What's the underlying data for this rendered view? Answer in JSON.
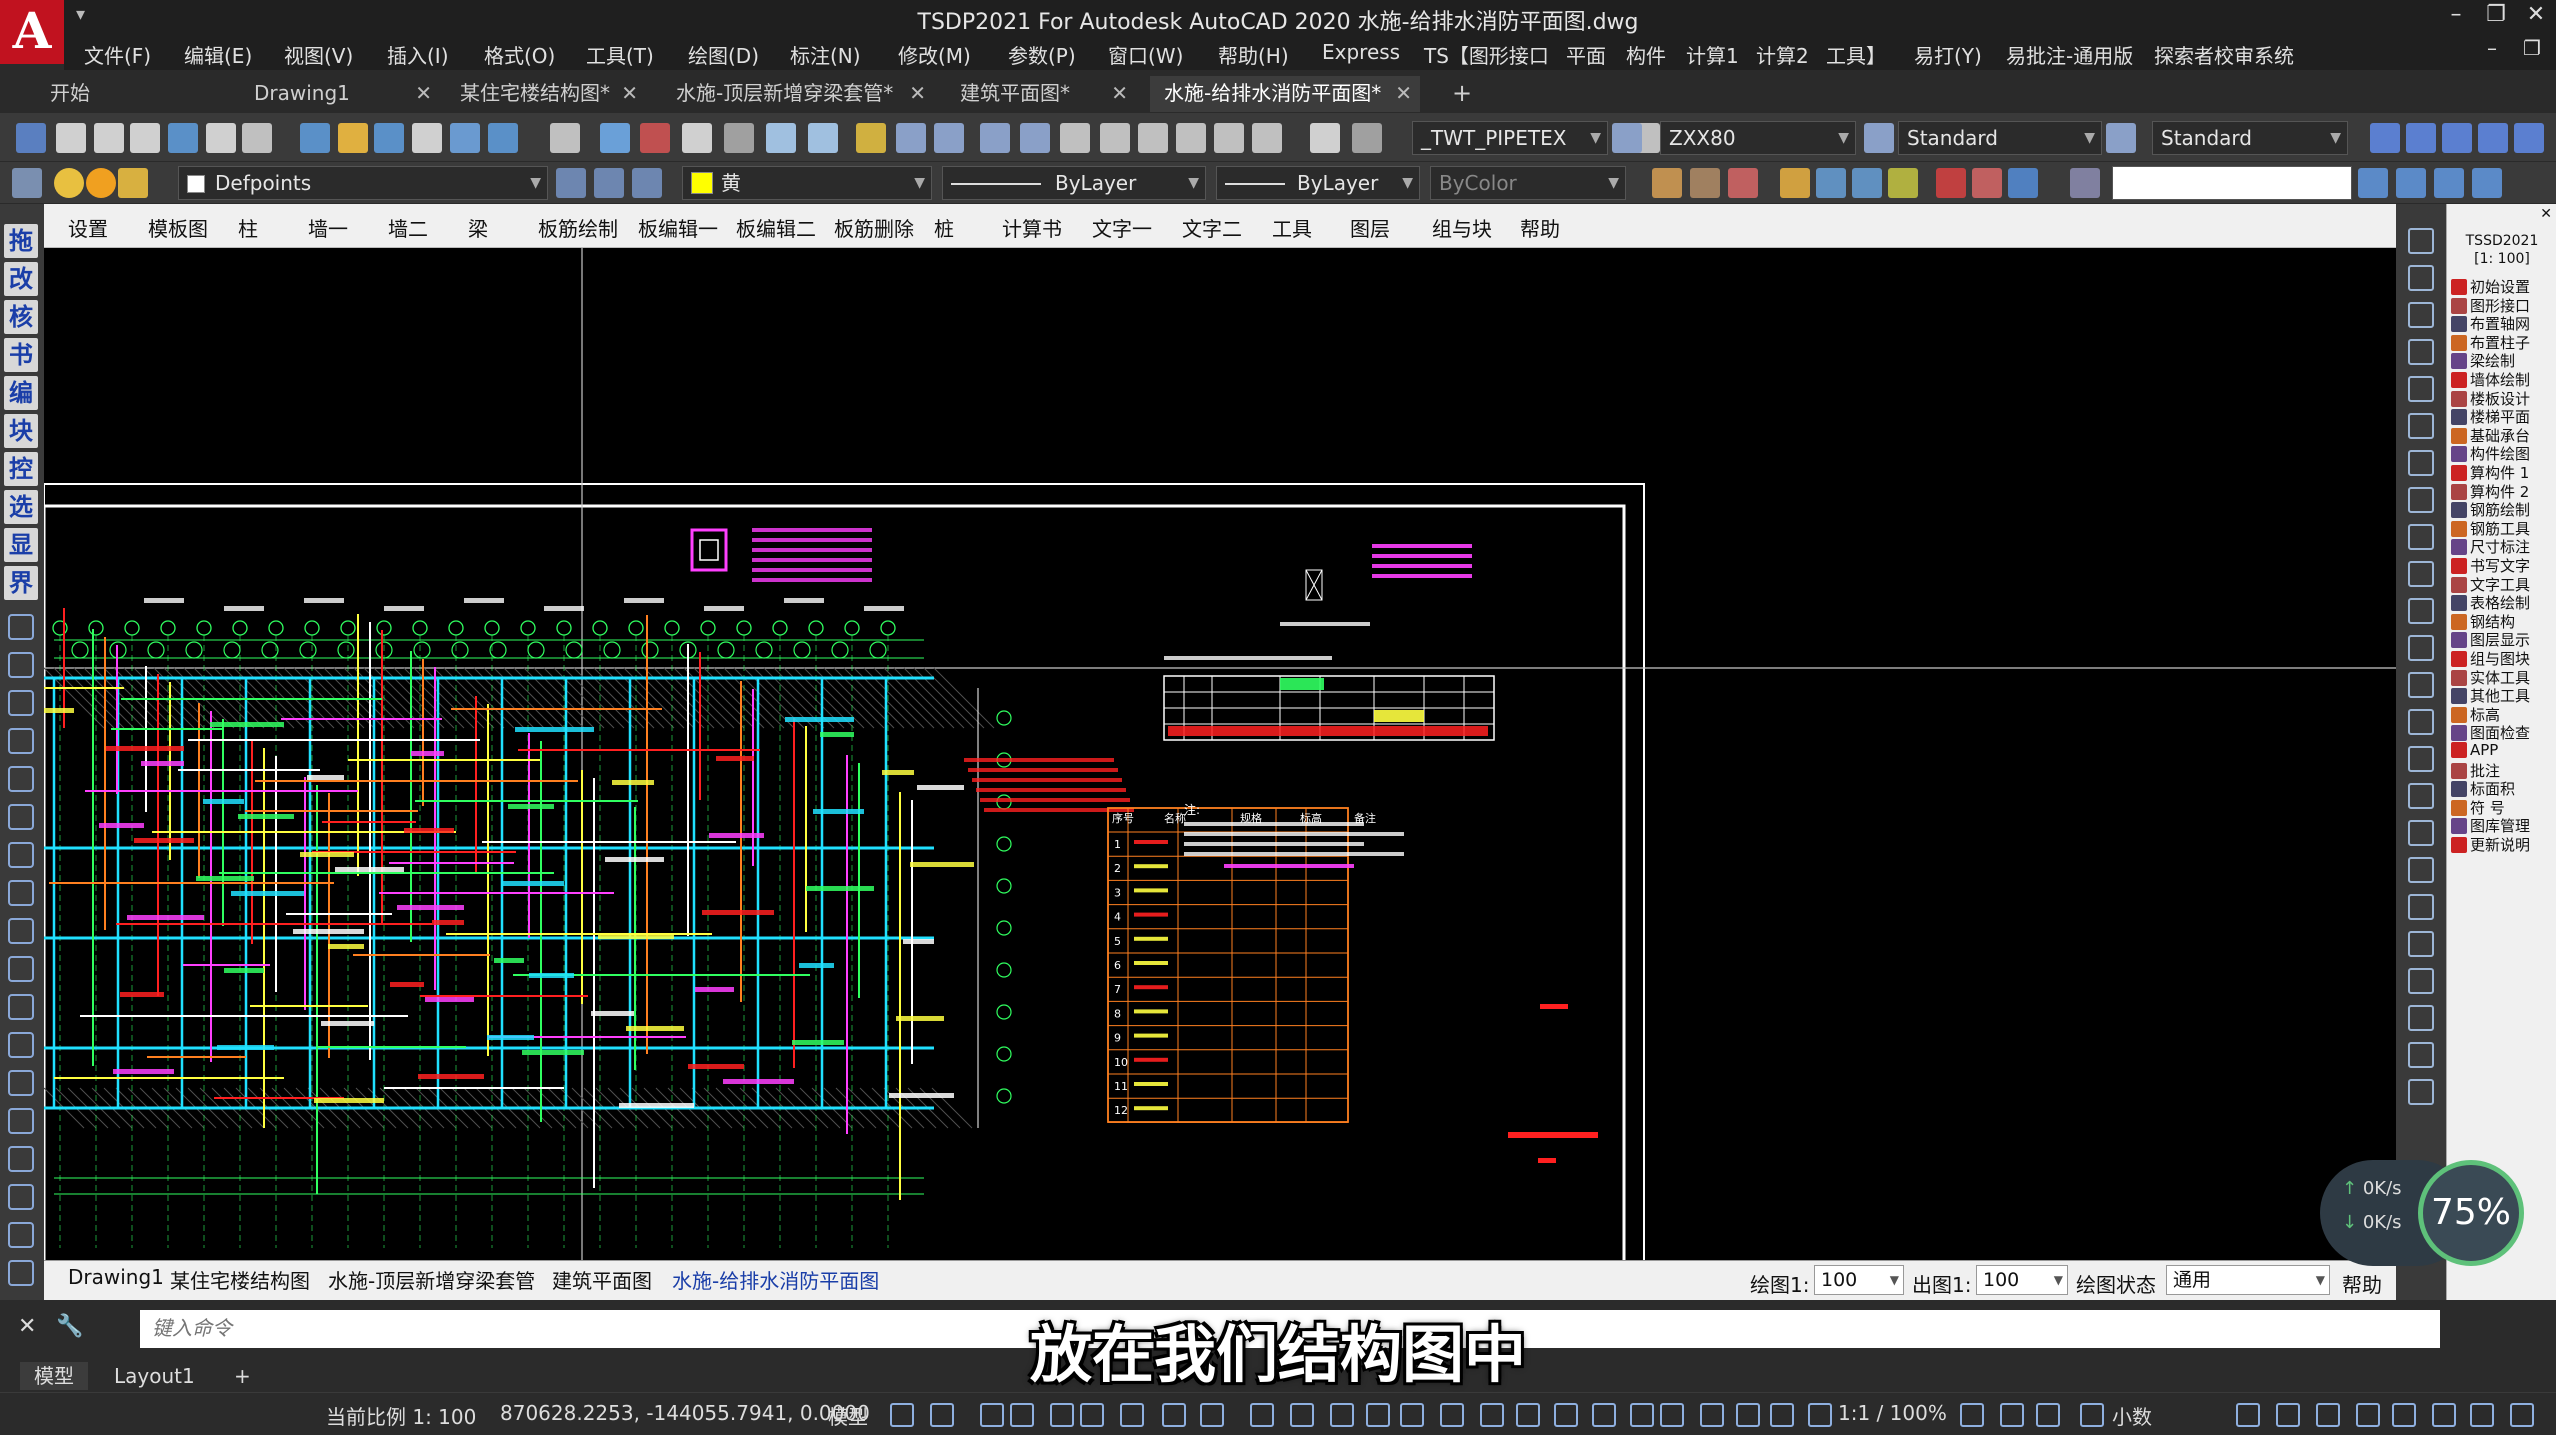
{
  "titlebar": {
    "title": "TSDP2021 For Autodesk AutoCAD 2020   水施-给排水消防平面图.dwg",
    "logo": "A"
  },
  "menu": [
    "文件(F)",
    "编辑(E)",
    "视图(V)",
    "插入(I)",
    "格式(O)",
    "工具(T)",
    "绘图(D)",
    "标注(N)",
    "修改(M)",
    "参数(P)",
    "窗口(W)",
    "帮助(H)",
    "Express",
    "TS【图形接口",
    "平面",
    "构件",
    "计算1",
    "计算2",
    "工具】",
    "易打(Y)",
    "易批注-通用版",
    "探索者校审系统"
  ],
  "tabs": [
    {
      "label": "开始",
      "active": false,
      "closable": false
    },
    {
      "label": "Drawing1",
      "active": false,
      "closable": true
    },
    {
      "label": "某住宅楼结构图*",
      "active": false,
      "closable": true
    },
    {
      "label": "水施-顶层新增穿梁套管*",
      "active": false,
      "closable": true
    },
    {
      "label": "建筑平面图*",
      "active": false,
      "closable": true
    },
    {
      "label": "水施-给排水消防平面图*",
      "active": true,
      "closable": true
    }
  ],
  "add_tab": "+",
  "toolbar": {
    "text_style": "_TWT_PIPETEX",
    "dim_style": "ZXX80",
    "table_style": "Standard",
    "multileader_style": "Standard",
    "layer": "Defpoints",
    "color": "黄",
    "linetype": "ByLayer",
    "lineweight": "ByLayer",
    "plotstyle": "ByColor"
  },
  "tssd_menu": [
    "设置",
    "模板图",
    "柱",
    "墙一",
    "墙二",
    "梁",
    "板筋绘制",
    "板编辑一",
    "板编辑二",
    "板筋删除",
    "桩",
    "计算书",
    "文字一",
    "文字二",
    "工具",
    "图层",
    "组与块",
    "帮助"
  ],
  "left_buttons": [
    "拖",
    "改",
    "核",
    "书",
    "编",
    "块",
    "控",
    "选",
    "显",
    "界"
  ],
  "right_panel": {
    "title": "TSSD2021",
    "scale": "[1: 100]",
    "items": [
      "初始设置",
      "图形接口",
      "布置轴网",
      "布置柱子",
      "梁绘制",
      "墙体绘制",
      "楼板设计",
      "楼梯平面",
      "基础承台",
      "构件绘图",
      "算构件 1",
      "算构件 2",
      "钢筋绘制",
      "钢筋工具",
      "尺寸标注",
      "书写文字",
      "文字工具",
      "表格绘制",
      "钢结构",
      "图层显示",
      "组与图块",
      "实体工具",
      "其他工具",
      "标高",
      "图面检查",
      "APP",
      "批注",
      "标面积",
      "符 号",
      "图库管理",
      "更新说明"
    ]
  },
  "layout_tabs": [
    "Drawing1",
    "某住宅楼结构图",
    "水施-顶层新增穿梁套管",
    "建筑平面图",
    "水施-给排水消防平面图"
  ],
  "layout_active": 4,
  "layout_controls": {
    "draw_scale_label": "绘图1:",
    "draw_scale": "100",
    "out_scale_label": "出图1:",
    "out_scale": "100",
    "state_label": "绘图状态",
    "state": "通用",
    "help": "帮助"
  },
  "command": {
    "placeholder": "键入命令"
  },
  "model_tabs": [
    {
      "label": "模型",
      "active": true
    },
    {
      "label": "Layout1",
      "active": false
    }
  ],
  "model_add": "+",
  "status": {
    "scale": "当前比例 1: 100",
    "coords": "870628.2253, -144055.7941, 0.0000",
    "mode": "模型",
    "annotation_scale": "1:1 / 100%",
    "units": "小数"
  },
  "subtitle": "放在我们结构图中",
  "network": {
    "up": "0K/s",
    "down": "0K/s",
    "percent": "75%"
  },
  "drawing": {
    "table_rows": [
      "1",
      "2",
      "3",
      "4",
      "5",
      "6",
      "7",
      "8",
      "9",
      "10",
      "11",
      "12"
    ],
    "table_header": [
      "序号",
      "名称",
      "规格",
      "标高",
      "备注"
    ],
    "note_title": "注:"
  },
  "colors": {
    "canvas": "#000000",
    "accent": "#c1121f",
    "cad_red": "#ff2020",
    "cad_yellow": "#ffff40",
    "cad_cyan": "#20e0ff",
    "cad_magenta": "#ff40ff",
    "cad_green": "#30ff60"
  }
}
